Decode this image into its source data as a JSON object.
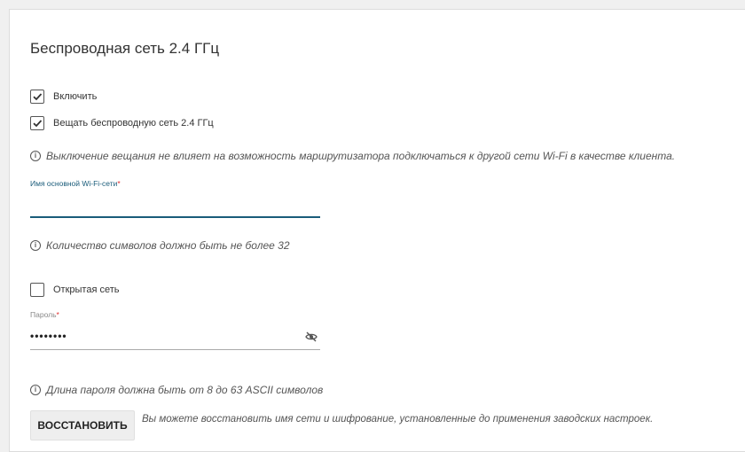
{
  "section": {
    "title": "Беспроводная сеть 2.4 ГГц"
  },
  "checkboxes": {
    "enable": {
      "label": "Включить",
      "checked": true
    },
    "broadcast": {
      "label": "Вещать беспроводную сеть 2.4 ГГц",
      "checked": true
    },
    "open_network": {
      "label": "Открытая сеть",
      "checked": false
    }
  },
  "info": {
    "icon": "i",
    "broadcast_note": "Выключение вещания не влияет на возможность маршрутизатора подключаться к другой сети Wi-Fi в качестве клиента.",
    "ssid_note": "Количество символов должно быть не более 32",
    "password_note": "Длина пароля должна быть от 8 до 63 ASCII символов"
  },
  "ssid": {
    "label": "Имя основной Wi-Fi-сети",
    "required_mark": "*",
    "value": ""
  },
  "password": {
    "label": "Пароль",
    "required_mark": "*",
    "value": "••••••••"
  },
  "restore": {
    "button_label": "ВОССТАНОВИТЬ",
    "note": "Вы можете восстановить имя сети и шифрование, установленные до применения заводских настроек."
  },
  "colors": {
    "accent": "#1a5c7a",
    "required": "#e03030"
  }
}
